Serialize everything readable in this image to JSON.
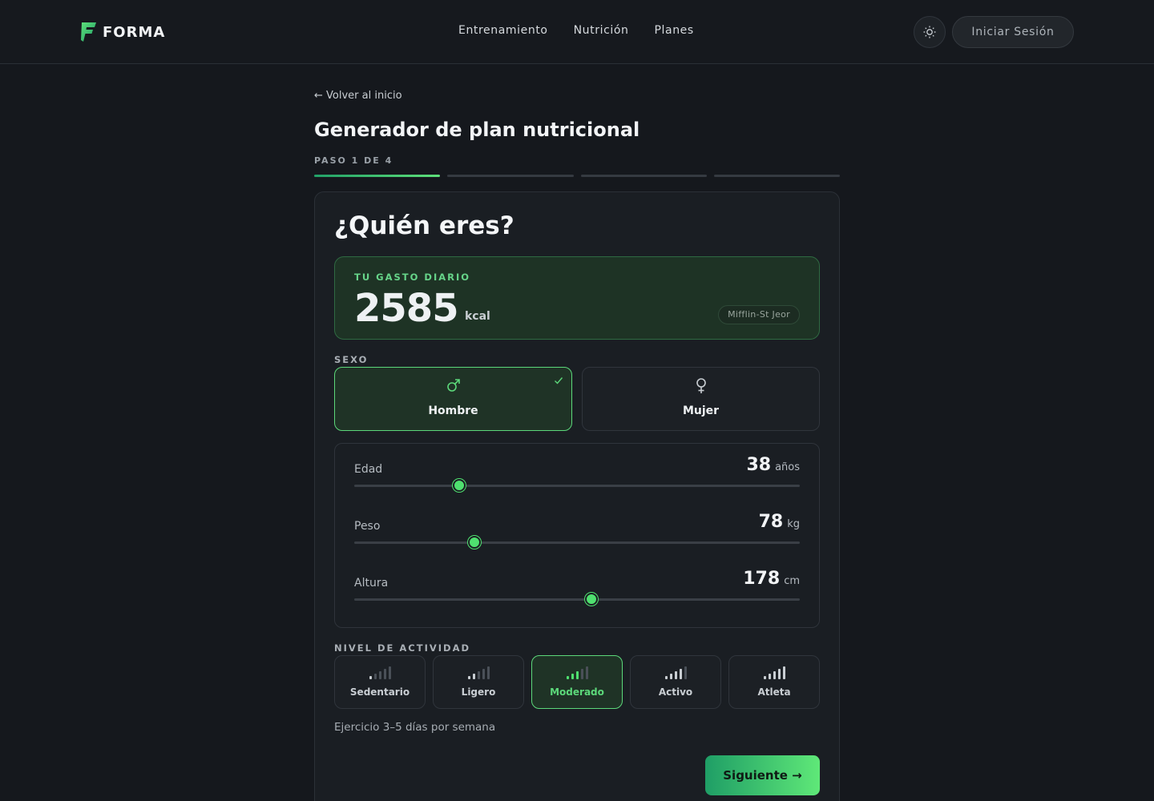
{
  "header": {
    "brand": "FORMA",
    "nav": [
      "Entrenamiento",
      "Nutrición",
      "Planes"
    ],
    "login_label": "Iniciar Sesión",
    "theme_icon": "sun-icon"
  },
  "page": {
    "back_link": "← Volver al inicio",
    "title": "Generador de plan nutricional",
    "step_label": "PASO 1 DE 4",
    "progress": {
      "current_step": 1,
      "total_steps": 4
    }
  },
  "card": {
    "title": "¿Quién eres?",
    "tdee": {
      "label": "TU GASTO DIARIO",
      "value": "2585",
      "unit": "kcal",
      "formula": "Mifflin-St Jeor"
    },
    "sex": {
      "label": "SEXO",
      "options": [
        {
          "label": "Hombre",
          "symbol": "♂",
          "selected": true
        },
        {
          "label": "Mujer",
          "symbol": "♀",
          "selected": false
        }
      ]
    },
    "sliders": [
      {
        "name": "Edad",
        "value": "38",
        "unit": "años",
        "fraction": 0.236
      },
      {
        "name": "Peso",
        "value": "78",
        "unit": "kg",
        "fraction": 0.27
      },
      {
        "name": "Altura",
        "value": "178",
        "unit": "cm",
        "fraction": 0.532
      }
    ],
    "activity": {
      "label": "NIVEL DE ACTIVIDAD",
      "options": [
        {
          "label": "Sedentario",
          "level": 1,
          "selected": false
        },
        {
          "label": "Ligero",
          "level": 2,
          "selected": false
        },
        {
          "label": "Moderado",
          "level": 3,
          "selected": true
        },
        {
          "label": "Activo",
          "level": 4,
          "selected": false
        },
        {
          "label": "Atleta",
          "level": 5,
          "selected": false
        }
      ],
      "description": "Ejercicio 3–5 días por semana"
    },
    "next_label": "Siguiente →"
  },
  "colors": {
    "accent": "#4fe06f",
    "background": "#15181d",
    "card": "#1a1e23"
  }
}
